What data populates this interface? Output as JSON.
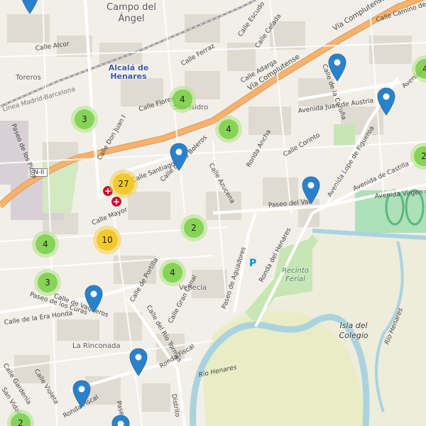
{
  "map": {
    "places": {
      "campo_del_angel": "Campo del Ángel",
      "alcala": "Alcalá de Henares",
      "toreros": "Toreros",
      "san_isidro": "San Isidro",
      "venecia": "Venecia",
      "la_rinconada": "La Rinconada",
      "isla_del_colegio": "Isla del Colegio",
      "recinto_ferial": "Recinto Ferial",
      "rio_henares_1": "Río Henares",
      "rio_henares_2": "Río Henares",
      "road_shield": "N-II",
      "parking": "P"
    },
    "streets": {
      "via_complutense_1": "Vía Complutense",
      "via_complutense_2": "Vía Complutense",
      "paseo_del_val": "Paseo del Val",
      "avenida_juan_de_austria": "Avenida Juan de Austria",
      "avenida_castilla": "Avenida de Castilla",
      "avenida_virgen": "Avenida Virgen del Val",
      "avenida_lope": "Avenida Lope de Figueroa",
      "calle_alcor": "Calle Alcor",
      "calle_flores": "Calle Flores",
      "calle_ferraz": "Calle Ferraz",
      "calle_adarga": "Calle Adarga",
      "calle_escudo": "Calle Escudo",
      "calle_celada": "Calle Celada",
      "calle_corinto": "Calle Corinto",
      "calle_arucena": "Calle Azucena",
      "ronda_ancha": "Ronda Ancha",
      "calle_don_juan": "Calle Don Juan I",
      "calle_santiago": "Calle Santiago",
      "calle_mayor": "Calle Mayor",
      "calle_portilla": "Calle de Portilla",
      "calle_gran_canal": "Calle Gran Canal",
      "calle_rio_tormes": "Calle del Río Tormes",
      "calle_vaqueros": "Calle de Vaqueros",
      "paseo_curas": "Paseo de los Curas",
      "calle_era_honda": "Calle de la Era Honda",
      "paseo_pinos": "Paseo de los Pinos",
      "paseo_aguadores": "Paseo de Aguadores",
      "ronda_henares": "Ronda del Henares",
      "ronda_fiscal": "Ronda Fiscal",
      "ronda_fiscal_2": "Ronda Fiscal",
      "calle_violeta": "Calle Violeta",
      "calle_gardenia": "Calle Gardenia",
      "san_vidal": "San Vidal",
      "ronda_madrid": "Línea Madrid-Barcelona",
      "calle_camino": "Calle Camino de",
      "calle_coruna": "Calle de la Coruña",
      "avenida_e": "Avenida",
      "calle_de_boleros": "Calle de los Boleros",
      "paseo_pastrana": "Paseo",
      "distrito": "Distrito"
    },
    "clusters": [
      {
        "count": "3"
      },
      {
        "count": "4"
      },
      {
        "count": "4"
      },
      {
        "count": "27"
      },
      {
        "count": "10"
      },
      {
        "count": "4"
      },
      {
        "count": "2"
      },
      {
        "count": "4"
      },
      {
        "count": "3"
      },
      {
        "count": "2"
      },
      {
        "count": "2"
      },
      {
        "count": "4"
      }
    ],
    "colors": {
      "cluster_green": "#6ecc39",
      "cluster_yellow": "#f0c20c",
      "pin_blue": "#2a81cb",
      "main_road": "#f9b16e",
      "river": "#aad3df",
      "park": "#c8e6b4"
    }
  }
}
